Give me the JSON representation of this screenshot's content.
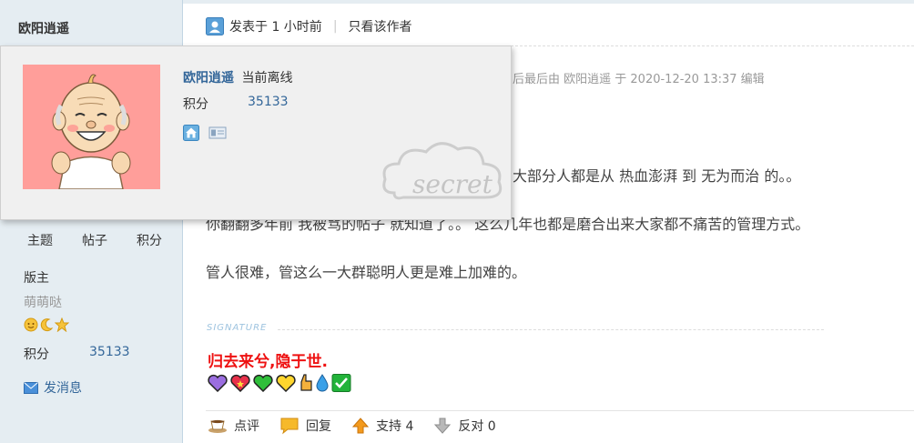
{
  "author": {
    "name": "欧阳逍遥"
  },
  "left_stats": [
    {
      "label": "主题"
    },
    {
      "label": "帖子"
    },
    {
      "label": "积分"
    }
  ],
  "profile": {
    "role": "版主",
    "nickname": "萌萌哒",
    "medals": [
      "sun-medal-icon",
      "moon-medal-icon",
      "star-medal-icon"
    ],
    "score_label": "积分",
    "score_value": "35133",
    "send_message": "发消息"
  },
  "post_header": {
    "posted": "发表于 1 小时前",
    "separator": "|",
    "author_only": "只看该作者"
  },
  "edit_note": "后最后由 欧阳逍遥 于 2020-12-20 13:37 编辑",
  "content": {
    "line1": "大部分人都是从 热血澎湃  到 无为而治 的。。",
    "line2": "你翻翻多年前 我被骂的帖子 就知道了。。  这么几年也都是磨合出来大家都不痛苦的管理方式。",
    "line3": "管人很难，管这么一大群聪明人更是难上加难的。"
  },
  "signature": {
    "label": "SIGNATURE",
    "text": "归去来兮,隐于世.",
    "emojis": [
      "purple-heart-icon",
      "sparkling-heart-icon",
      "green-heart-icon",
      "yellow-heart-icon",
      "thumb-up-icon",
      "droplet-icon",
      "check-box-icon"
    ]
  },
  "actions": {
    "comment": "点评",
    "reply": "回复",
    "support": "支持 4",
    "oppose": "反对 0"
  },
  "popup": {
    "name": "欧阳逍遥",
    "status": "当前离线",
    "score_label": "积分",
    "score_value": "35133",
    "watermark": "secret"
  },
  "colors": {
    "link": "#336699",
    "sidebar_bg": "#e5edf2",
    "signature_red": "#ee1111",
    "avatar_bg": "#ff9e9a"
  }
}
